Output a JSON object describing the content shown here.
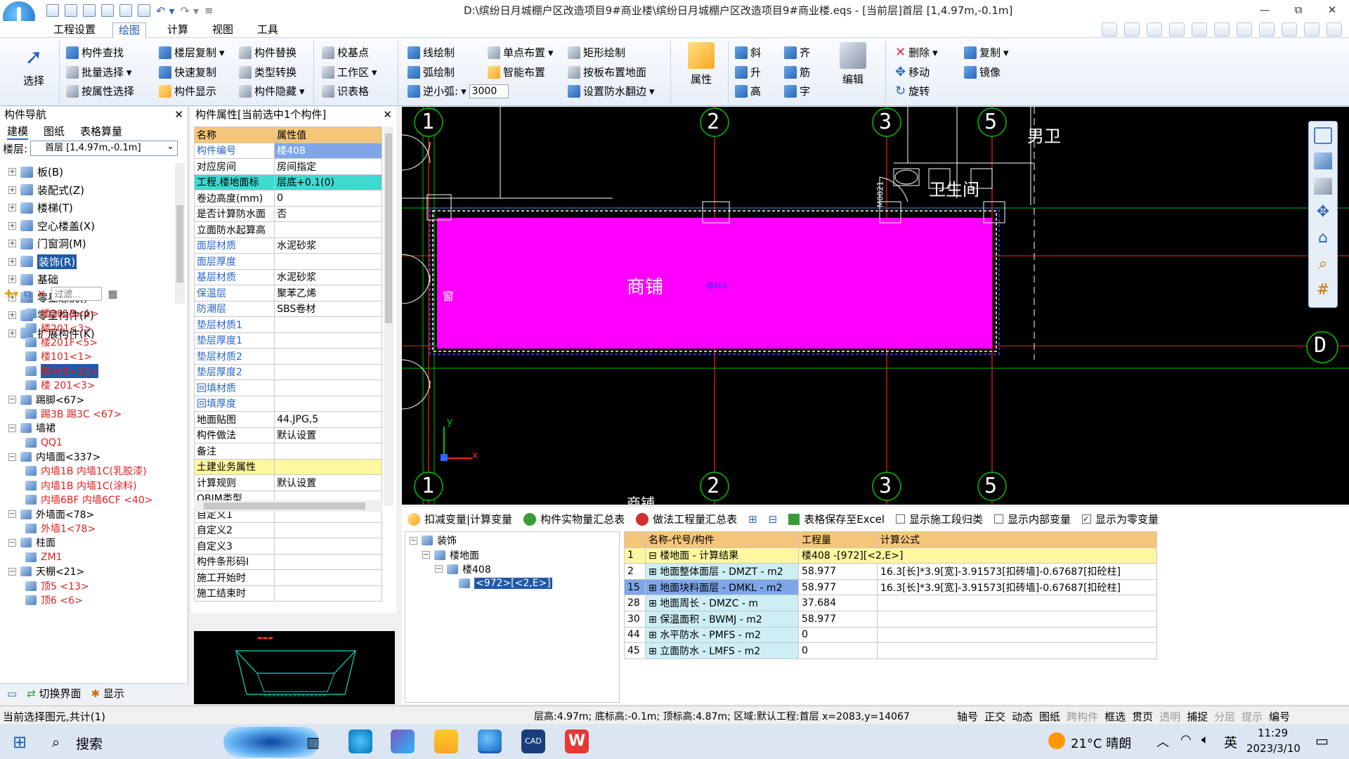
{
  "window": {
    "title": "D:\\缤纷日月城棚户区改造项目9#商业楼\\缤纷日月城棚户区改造项目9#商业楼.eqs - [当前层]首层 [1,4.97m,-0.1m]",
    "controls": [
      "—",
      "⧉",
      "✕"
    ]
  },
  "menu": {
    "tabs": [
      "工程设置",
      "绘图",
      "计算",
      "视图",
      "工具"
    ],
    "active": "绘图"
  },
  "ribbon": {
    "select": "选择",
    "group1": [
      "构件查找",
      "批量选择",
      "按属性选择"
    ],
    "group2": [
      "楼层复制",
      "快速复制",
      "构件显示"
    ],
    "group3": [
      "构件替换",
      "类型转换",
      "构件隐藏"
    ],
    "group4": [
      "校基点",
      "工作区",
      "识表格"
    ],
    "group5": [
      "线绘制",
      "弧绘制",
      "逆小弧:"
    ],
    "arc_value": "3000",
    "group6": [
      "单点布置",
      "智能布置"
    ],
    "group7": [
      "矩形绘制",
      "按板布置地面",
      "设置防水翻边"
    ],
    "attr": "属性",
    "group8": [
      "斜",
      "升",
      "高"
    ],
    "group9": [
      "齐",
      "筋",
      "字"
    ],
    "edit": "编辑",
    "group10": [
      "删除",
      "移动",
      "旋转"
    ],
    "group11": [
      "复制",
      "镜像"
    ]
  },
  "nav": {
    "title": "构件导航",
    "tabs": [
      "建模",
      "图纸",
      "表格算量"
    ],
    "floor_label": "楼层:",
    "floor_value": "首层 [1,4.97m,-0.1m]",
    "categories": [
      "板(B)",
      "装配式(Z)",
      "楼梯(T)",
      "空心楼盖(X)",
      "门窗洞(M)",
      "装饰(R)",
      "基础",
      "零星悬挑()",
      "零星构件(P)",
      "扩展构件(K)"
    ],
    "filter_placeholder": "过滤...",
    "tree": [
      {
        "t": "楼201B<1>",
        "red": true,
        "lvl": 3
      },
      {
        "t": "楼201<3>",
        "red": true,
        "lvl": 3
      },
      {
        "t": "楼201F<5>",
        "red": true,
        "lvl": 3
      },
      {
        "t": "楼101<1>",
        "red": true,
        "lvl": 3
      },
      {
        "t": "楼408<10>",
        "red": true,
        "lvl": 3,
        "sel": true
      },
      {
        "t": "楼 201<3>",
        "red": true,
        "lvl": 3
      },
      {
        "t": "踢脚<67>",
        "red": false,
        "lvl": 1
      },
      {
        "t": "踢3B 踢3C <67>",
        "red": true,
        "lvl": 3
      },
      {
        "t": "墙裙",
        "red": false,
        "lvl": 1
      },
      {
        "t": "QQ1",
        "red": true,
        "lvl": 3
      },
      {
        "t": "内墙面<337>",
        "red": false,
        "lvl": 1
      },
      {
        "t": "内墙1B 内墙1C(乳胶漆)",
        "red": true,
        "lvl": 3
      },
      {
        "t": "内墙1B 内墙1C(涂料)",
        "red": true,
        "lvl": 3
      },
      {
        "t": "内墙6BF 内墙6CF <40>",
        "red": true,
        "lvl": 3
      },
      {
        "t": "外墙面<78>",
        "red": false,
        "lvl": 1
      },
      {
        "t": "外墙1<78>",
        "red": true,
        "lvl": 3
      },
      {
        "t": "柱面",
        "red": false,
        "lvl": 1
      },
      {
        "t": "ZM1",
        "red": true,
        "lvl": 3
      },
      {
        "t": "天棚<21>",
        "red": false,
        "lvl": 1
      },
      {
        "t": "顶5 <13>",
        "red": true,
        "lvl": 3
      },
      {
        "t": "顶6 <6>",
        "red": true,
        "lvl": 3
      }
    ],
    "bottom": [
      "切换界面",
      "显示"
    ]
  },
  "props": {
    "title": "构件属性[当前选中1个构件]",
    "col_name": "名称",
    "col_value": "属性值",
    "rows": [
      {
        "k": "构件编号",
        "v": "楼408",
        "style": "blue"
      },
      {
        "k": "对应房间",
        "v": "房间指定"
      },
      {
        "k": "工程.楼地面标",
        "v": "层底+0.1(0)",
        "style": "cyan"
      },
      {
        "k": "卷边高度(mm)",
        "v": "0"
      },
      {
        "k": "是否计算防水面",
        "v": "否"
      },
      {
        "k": "立面防水起算高",
        "v": ""
      },
      {
        "k": "面层材质",
        "v": "水泥砂浆",
        "kb": true
      },
      {
        "k": "面层厚度",
        "v": "",
        "kb": true
      },
      {
        "k": "基层材质",
        "v": "水泥砂浆",
        "kb": true
      },
      {
        "k": "保温层",
        "v": "聚苯乙烯",
        "kb": true
      },
      {
        "k": "防潮层",
        "v": "SBS卷材",
        "kb": true
      },
      {
        "k": "垫层材质1",
        "v": "",
        "kb": true
      },
      {
        "k": "垫层厚度1",
        "v": "",
        "kb": true
      },
      {
        "k": "垫层材质2",
        "v": "",
        "kb": true
      },
      {
        "k": "垫层厚度2",
        "v": "",
        "kb": true
      },
      {
        "k": "回填材质",
        "v": "",
        "kb": true
      },
      {
        "k": "回填厚度",
        "v": "",
        "kb": true
      },
      {
        "k": "地面贴图",
        "v": "44.JPG,5"
      },
      {
        "k": "构件做法",
        "v": "默认设置"
      },
      {
        "k": "备注",
        "v": ""
      },
      {
        "k": "土建业务属性",
        "v": "",
        "style": "yellow"
      },
      {
        "k": "计算规则",
        "v": "默认设置"
      },
      {
        "k": "QBIM类型",
        "v": ""
      },
      {
        "k": "自定义1",
        "v": ""
      },
      {
        "k": "自定义2",
        "v": ""
      },
      {
        "k": "自定义3",
        "v": ""
      },
      {
        "k": "构件条形码I",
        "v": ""
      },
      {
        "k": "施工开始时",
        "v": ""
      },
      {
        "k": "施工结束时",
        "v": ""
      }
    ]
  },
  "canvas": {
    "axes_top": [
      "1",
      "2",
      "3",
      "5"
    ],
    "axes_bottom": [
      "1",
      "2",
      "3",
      "5"
    ],
    "axis_right": "D",
    "room_label": "商铺",
    "room_tag": "楼408",
    "bottom_label": "商铺",
    "wc_label": "卫生间",
    "men_wc": "男卫",
    "door_tag": "M0821",
    "left_tag": "窗",
    "x_label": "x",
    "y_label": "y"
  },
  "bottom": {
    "tabs": [
      "扣减变量|计算变量",
      "构件实物量汇总表",
      "做法工程量汇总表"
    ],
    "save_excel": "表格保存至Excel",
    "checks": [
      {
        "t": "显示施工段归类",
        "on": false
      },
      {
        "t": "显示内部变量",
        "on": false
      },
      {
        "t": "显示为零变量",
        "on": true
      }
    ],
    "tree": [
      "装饰",
      "楼地面",
      "楼408",
      "<972>[<2,E>]"
    ],
    "headers": [
      "名称-代号/构件",
      "工程量",
      "计算公式"
    ],
    "rows": [
      {
        "n": "1",
        "name": "楼地面 - 计算结果",
        "qty": "楼408 -[972][<2,E>]",
        "f": "",
        "y": true
      },
      {
        "n": "2",
        "name": "地面整体面层 - DMZT - m2",
        "qty": "58.977",
        "f": "16.3[长]*3.9[宽]-3.91573[扣砖墙]-0.67687[扣砼柱]"
      },
      {
        "n": "15",
        "name": "地面块料面层 - DMKL - m2",
        "qty": "58.977",
        "f": "16.3[长]*3.9[宽]-3.91573[扣砖墙]-0.67687[扣砼柱]",
        "sel": true
      },
      {
        "n": "28",
        "name": "地面周长 - DMZC - m",
        "qty": "37.684",
        "f": ""
      },
      {
        "n": "30",
        "name": "保温面积 - BWMJ - m2",
        "qty": "58.977",
        "f": ""
      },
      {
        "n": "44",
        "name": "水平防水 - PMFS - m2",
        "qty": "0",
        "f": ""
      },
      {
        "n": "45",
        "name": "立面防水 - LMFS - m2",
        "qty": "0",
        "f": ""
      }
    ]
  },
  "status": {
    "left": "当前选择图元,共计(1)",
    "mid": "层高:4.97m; 底标高:-0.1m; 顶标高:4.87m; 区域:默认工程:首层 x=2083,y=14067",
    "right": [
      "轴号",
      "正交",
      "动态",
      "图纸",
      "跨构件",
      "框选",
      "贯页",
      "透明",
      "捕捉",
      "分层",
      "提示",
      "编号"
    ]
  },
  "taskbar": {
    "search": "搜索",
    "weather": "21°C 晴朗",
    "ime": "英",
    "time": "11:29",
    "date": "2023/3/10"
  },
  "colors": {
    "magenta": "#ff00ff",
    "canvas_bg": "#000000",
    "accent": "#1f5aa6"
  }
}
